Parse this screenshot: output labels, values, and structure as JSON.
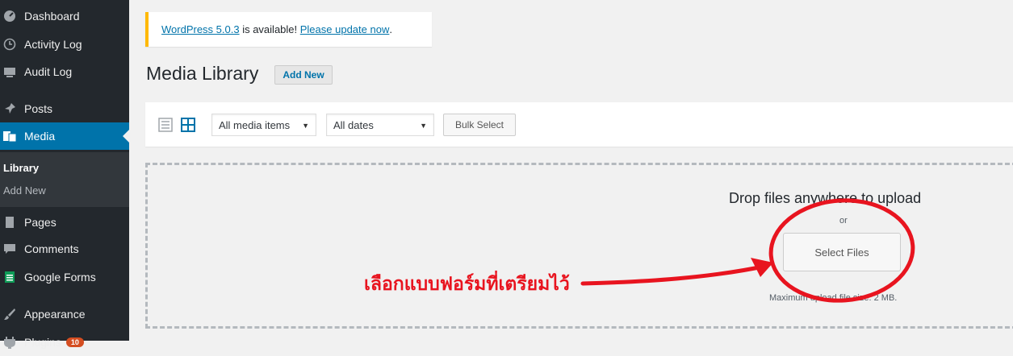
{
  "sidebar": {
    "items": [
      {
        "label": "Dashboard",
        "icon": "dashboard-icon"
      },
      {
        "label": "Activity Log",
        "icon": "clock-icon"
      },
      {
        "label": "Audit Log",
        "icon": "monitor-icon"
      },
      {
        "label": "Posts",
        "icon": "pin-icon"
      },
      {
        "label": "Media",
        "icon": "media-icon"
      },
      {
        "label": "Pages",
        "icon": "page-icon"
      },
      {
        "label": "Comments",
        "icon": "comment-icon"
      },
      {
        "label": "Google Forms",
        "icon": "forms-icon"
      },
      {
        "label": "Appearance",
        "icon": "brush-icon"
      },
      {
        "label": "Plugins",
        "icon": "plugin-icon",
        "badge": "10"
      }
    ],
    "submenu": [
      {
        "label": "Library"
      },
      {
        "label": "Add New"
      }
    ]
  },
  "notice": {
    "version_link": "WordPress 5.0.3",
    "text": " is available! ",
    "update_link": "Please update now",
    "period": "."
  },
  "header": {
    "title": "Media Library",
    "add_new": "Add New"
  },
  "toolbar": {
    "filter_type": "All media items",
    "filter_date": "All dates",
    "bulk_select": "Bulk Select"
  },
  "upload": {
    "drop_text": "Drop files anywhere to upload",
    "or_text": "or",
    "select_files": "Select Files",
    "max_size": "Maximum upload file size: 2 MB."
  },
  "annotation": {
    "text": "เลือกแบบฟอร์มที่เตรียมไว้",
    "color": "#e8141f"
  },
  "colors": {
    "sidebar_bg": "#23282d",
    "active_bg": "#0073aa",
    "notice_border": "#ffb900",
    "link": "#0073aa"
  }
}
